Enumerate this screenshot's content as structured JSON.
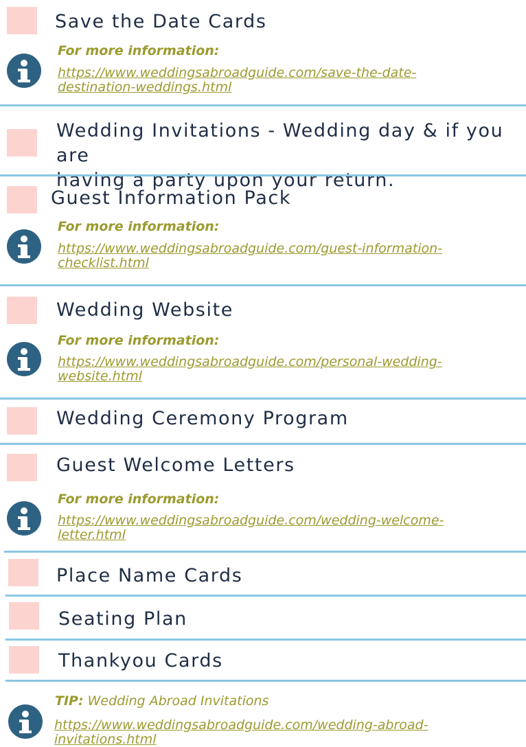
{
  "items": [
    {
      "title": "Save the Date Cards",
      "info_heading": "For more information:",
      "link_line1": "https://www.weddingsabroadguide.com/save-the-date-",
      "link_line2": "destination-weddings.html"
    },
    {
      "title_line1": "Wedding Invitations - Wedding day & if you are",
      "title_line2": "having a party upon your return."
    },
    {
      "title": "Guest Information Pack",
      "info_heading": "For more information:",
      "link_line1": "https://www.weddingsabroadguide.com/guest-information-",
      "link_line2": "checklist.html"
    },
    {
      "title": "Wedding Website",
      "info_heading": "For more information:",
      "link_line1": "https://www.weddingsabroadguide.com/personal-wedding-",
      "link_line2": "website.html"
    },
    {
      "title": "Wedding Ceremony Program"
    },
    {
      "title": "Guest Welcome Letters",
      "info_heading": "For more information:",
      "link_line1": "https://www.weddingsabroadguide.com/wedding-welcome-",
      "link_line2": "letter.html"
    },
    {
      "title": "Place Name Cards"
    },
    {
      "title": "Seating Plan"
    },
    {
      "title": "Thankyou Cards"
    }
  ],
  "tip": {
    "label": "TIP:",
    "text": " Wedding Abroad Invitations",
    "link_line1": "https://www.weddingsabroadguide.com/wedding-abroad-",
    "link_line2": "invitations.html"
  },
  "colors": {
    "checkbox": "#fdd3d0",
    "title": "#1f2e45",
    "divider": "#8ac6e3",
    "info_icon": "#2e6283",
    "link": "#9c9a2f"
  },
  "icons": {
    "info": "info-circle-icon"
  }
}
